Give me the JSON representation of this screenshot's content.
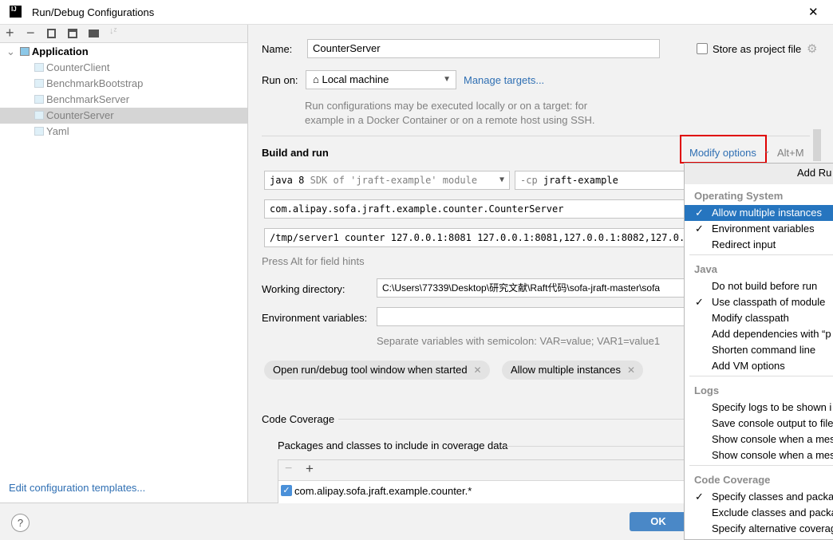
{
  "window": {
    "title": "Run/Debug Configurations",
    "close": "✕",
    "app_icon": "IJ"
  },
  "toolbar": {
    "add": "+",
    "remove": "−",
    "copy_icon": "copy-icon",
    "save_icon": "save-icon",
    "folder_icon": "new-folder-icon",
    "sort_icon": "sort-icon"
  },
  "tree": {
    "root": "Application",
    "items": [
      "CounterClient",
      "BenchmarkBootstrap",
      "BenchmarkServer",
      "CounterServer",
      "Yaml"
    ],
    "selected": "CounterServer"
  },
  "edit_templates": "Edit configuration templates...",
  "form": {
    "name_label": "Name:",
    "name_value": "CounterServer",
    "store_label": "Store as project file",
    "run_on_label": "Run on:",
    "run_on_value": "Local machine",
    "manage_targets": "Manage targets...",
    "run_on_hint1": "Run configurations may be executed locally or on a target: for",
    "run_on_hint2": "example in a Docker Container or on a remote host using SSH.",
    "build_run": "Build and run",
    "modify_options": "Modify options",
    "modify_shortcut": "Alt+M",
    "sdk_main": "java 8",
    "sdk_hint": "SDK of 'jraft-example' module",
    "cp_prefix": "-cp",
    "cp_value": "jraft-example",
    "main_class": "com.alipay.sofa.jraft.example.counter.CounterServer",
    "program_args": "/tmp/server1 counter 127.0.0.1:8081 127.0.0.1:8081,127.0.0.1:8082,127.0.0.1",
    "field_hint": "Press Alt for field hints",
    "workdir_label": "Working directory:",
    "workdir_value": "C:\\Users\\77339\\Desktop\\研究文献\\Raft代码\\sofa-jraft-master\\sofa",
    "env_label": "Environment variables:",
    "env_value": "",
    "env_hint": "Separate variables with semicolon: VAR=value; VAR1=value1",
    "chips": [
      "Open run/debug tool window when started",
      "Allow multiple instances"
    ],
    "coverage_title": "Code Coverage",
    "coverage_sub": "Packages and classes to include in coverage data",
    "coverage_item": "com.alipay.sofa.jraft.example.counter.*"
  },
  "buttons": {
    "ok": "OK",
    "help": "?"
  },
  "popup": {
    "header": "Add Ru",
    "sections": [
      {
        "title": "Operating System",
        "items": [
          {
            "label": "Allow multiple instances",
            "checked": true,
            "highlighted": true
          },
          {
            "label": "Environment variables",
            "checked": true
          },
          {
            "label": "Redirect input",
            "checked": false
          }
        ]
      },
      {
        "title": "Java",
        "items": [
          {
            "label": "Do not build before run",
            "checked": false
          },
          {
            "label": "Use classpath of module",
            "checked": true
          },
          {
            "label": "Modify classpath",
            "checked": false
          },
          {
            "label": "Add dependencies with “p",
            "checked": false
          },
          {
            "label": "Shorten command line",
            "checked": false
          },
          {
            "label": "Add VM options",
            "checked": false
          }
        ]
      },
      {
        "title": "Logs",
        "items": [
          {
            "label": "Specify logs to be shown i",
            "checked": false
          },
          {
            "label": "Save console output to file",
            "checked": false
          },
          {
            "label": "Show console when a mes",
            "checked": false
          },
          {
            "label": "Show console when a mes",
            "checked": false
          }
        ]
      },
      {
        "title": "Code Coverage",
        "items": [
          {
            "label": "Specify classes and packa",
            "checked": true
          },
          {
            "label": "Exclude classes and packa",
            "checked": false
          },
          {
            "label": "Specify alternative coverag",
            "checked": false
          }
        ]
      }
    ]
  },
  "colors": {
    "accent": "#2675bf",
    "link": "#2f6fb3",
    "highlight_box": "#e00000",
    "ok_button": "#4a88c7"
  }
}
